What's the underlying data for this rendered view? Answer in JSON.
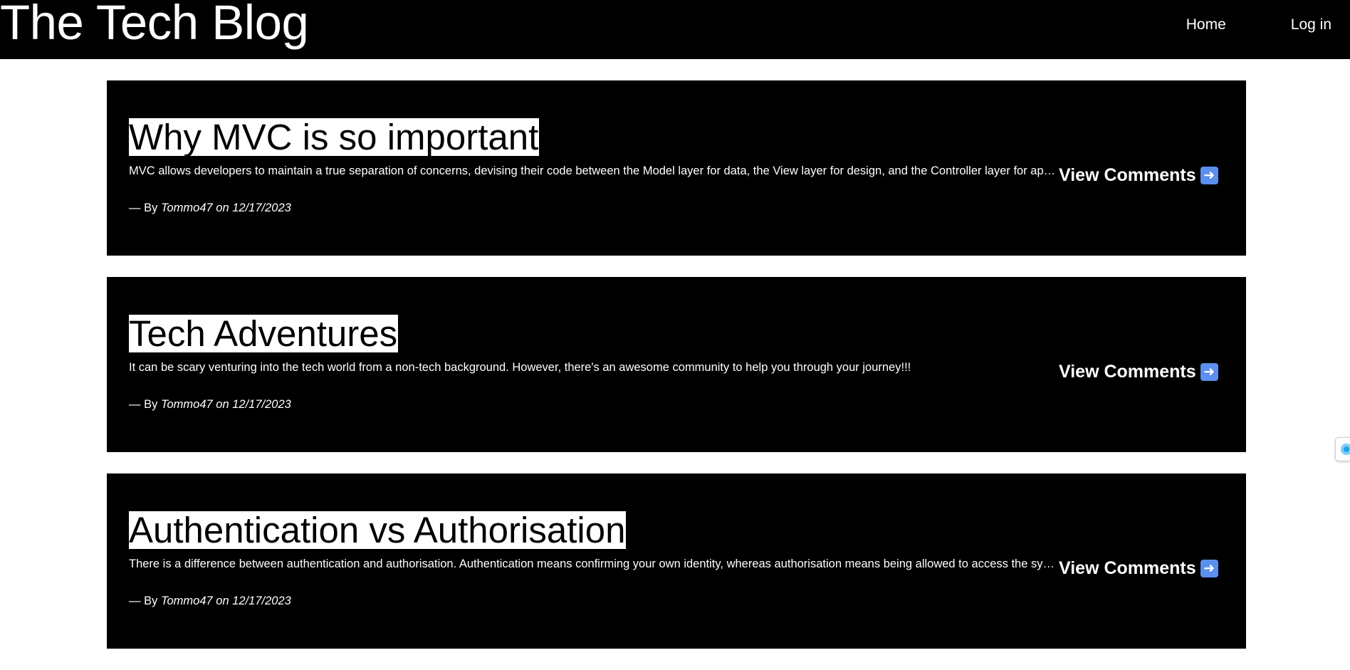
{
  "header": {
    "site_title": "The Tech Blog",
    "nav": [
      {
        "label": "Home"
      },
      {
        "label": "Log in"
      }
    ]
  },
  "posts": [
    {
      "title": "Why MVC is so important",
      "excerpt": "MVC allows developers to maintain a true separation of concerns, devising their code between the Model layer for data, the View layer for design, and the Controller layer for application logic.",
      "by_prefix": "— By",
      "author": "Tommo47",
      "on_word": "on",
      "date": "12/17/2023",
      "view_comments_label": "View Comments"
    },
    {
      "title": "Tech Adventures",
      "excerpt": "It can be scary venturing into the tech world from a non-tech background. However, there's an awesome community to help you through your journey!!!",
      "by_prefix": "— By",
      "author": "Tommo47",
      "on_word": "on",
      "date": "12/17/2023",
      "view_comments_label": "View Comments"
    },
    {
      "title": "Authentication vs Authorisation",
      "excerpt": "There is a difference between authentication and authorisation. Authentication means confirming your own identity, whereas authorisation means being allowed to access the system.",
      "by_prefix": "— By",
      "author": "Tommo47",
      "on_word": "on",
      "date": "12/17/2023",
      "view_comments_label": "View Comments"
    }
  ],
  "icons": {
    "view_comments_arrow": "right-arrow-icon",
    "floating_widget": "chat-widget-icon"
  },
  "colors": {
    "header_bg": "#000000",
    "post_bg": "#000000",
    "title_highlight_bg": "#ffffff",
    "arrow_icon_bg": "#5b8ff0"
  }
}
